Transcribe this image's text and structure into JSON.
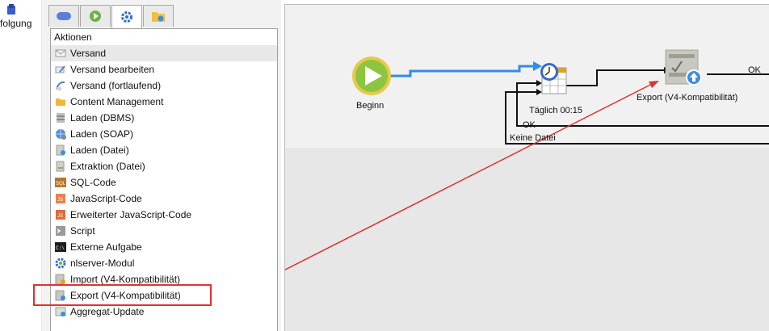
{
  "nav": {
    "label": "folgung"
  },
  "panel": {
    "tabs": [
      {
        "name": "tab-cloud",
        "icon": "cloud-icon",
        "active": false
      },
      {
        "name": "tab-play",
        "icon": "play-icon",
        "active": false
      },
      {
        "name": "tab-gear",
        "icon": "gear-icon",
        "active": true
      },
      {
        "name": "tab-folder",
        "icon": "folder-icon",
        "active": false
      }
    ],
    "header": "Aktionen",
    "items": [
      {
        "label": "Versand",
        "icon": "envelope-icon"
      },
      {
        "label": "Versand bearbeiten",
        "icon": "edit-delivery-icon"
      },
      {
        "label": "Versand (fortlaufend)",
        "icon": "continuous-delivery-icon"
      },
      {
        "label": "Content Management",
        "icon": "folder-content-icon"
      },
      {
        "label": "Laden (DBMS)",
        "icon": "database-load-icon"
      },
      {
        "label": "Laden (SOAP)",
        "icon": "globe-load-icon"
      },
      {
        "label": "Laden (Datei)",
        "icon": "file-load-icon"
      },
      {
        "label": "Extraktion (Datei)",
        "icon": "file-extract-icon"
      },
      {
        "label": "SQL-Code",
        "icon": "sql-icon"
      },
      {
        "label": "JavaScript-Code",
        "icon": "javascript-icon"
      },
      {
        "label": "Erweiterter JavaScript-Code",
        "icon": "advanced-javascript-icon"
      },
      {
        "label": "Script",
        "icon": "script-icon"
      },
      {
        "label": "Externe Aufgabe",
        "icon": "terminal-icon"
      },
      {
        "label": "nlserver-Modul",
        "icon": "module-gear-icon"
      },
      {
        "label": "Import (V4-Kompatibilität)",
        "icon": "import-icon"
      },
      {
        "label": "Export (V4-Kompatibilität)",
        "icon": "export-icon"
      },
      {
        "label": "Aggregat-Update",
        "icon": "aggregate-update-icon"
      }
    ]
  },
  "canvas": {
    "begin_label": "Beginn",
    "scheduler_label": "Täglich 00:15",
    "export_label": "Export (V4-Kompatibilität)",
    "ok_top": "OK",
    "ok_bottom": "OK",
    "no_file": "Keine Datei"
  },
  "colors": {
    "highlight": "#e03232",
    "flow_blue": "#2f8de4",
    "start_green": "#8cc63f"
  }
}
